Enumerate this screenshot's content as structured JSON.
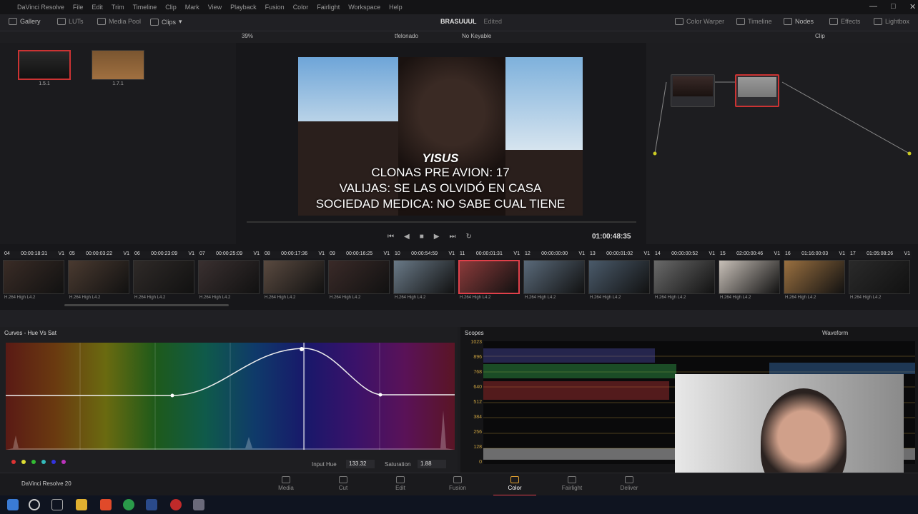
{
  "menu": {
    "app": "DaVinci Resolve",
    "items": [
      "File",
      "Edit",
      "Trim",
      "Timeline",
      "Clip",
      "Mark",
      "View",
      "Playback",
      "Fusion",
      "Color",
      "Fairlight",
      "Workspace",
      "Help"
    ]
  },
  "toolbar": {
    "gallery": "Gallery",
    "luts": "LUTs",
    "media_pool": "Media Pool",
    "clips": "Clips",
    "project": "BRASUUUL",
    "status": "Edited",
    "color_warper": "Color Warper",
    "timeline": "Timeline",
    "nodes": "Nodes",
    "effects": "Effects",
    "lightbox": "Lightbox"
  },
  "viewer": {
    "zoom": "39%",
    "clip_name": "tfelonado",
    "keyframe": "No Keyable",
    "mode": "Clip",
    "timecode": "01:00:48:35",
    "subtitle": {
      "name": "YISUS",
      "line1": "CLONAS PRE AVION: 17",
      "line2": "VALIJAS: SE LAS OLVIDÓ EN CASA",
      "line3": "SOCIEDAD MEDICA: NO SABE CUAL TIENE"
    }
  },
  "gallery": {
    "stills": [
      {
        "label": "1.5.1"
      },
      {
        "label": "1.7.1"
      }
    ]
  },
  "timeline": {
    "clips": [
      {
        "n": "04",
        "tc": "00:00:18:31",
        "tr": "V1",
        "codec": "H.264 High L4.2"
      },
      {
        "n": "05",
        "tc": "00:00:03:22",
        "tr": "V1",
        "codec": "H.264 High L4.2"
      },
      {
        "n": "06",
        "tc": "00:00:23:09",
        "tr": "V1",
        "codec": "H.264 High L4.2"
      },
      {
        "n": "07",
        "tc": "00:00:25:09",
        "tr": "V1",
        "codec": "H.264 High L4.2"
      },
      {
        "n": "08",
        "tc": "00:00:17:36",
        "tr": "V1",
        "codec": "H.264 High L4.2"
      },
      {
        "n": "09",
        "tc": "00:00:16:25",
        "tr": "V1",
        "codec": "H.264 High L4.2"
      },
      {
        "n": "10",
        "tc": "00:00:54:59",
        "tr": "V1",
        "codec": "H.264 High L4.2"
      },
      {
        "n": "11",
        "tc": "00:00:01:31",
        "tr": "V1",
        "codec": "H.264 High L4.2"
      },
      {
        "n": "12",
        "tc": "00:00:00:00",
        "tr": "V1",
        "codec": "H.264 High L4.2"
      },
      {
        "n": "13",
        "tc": "00:00:01:02",
        "tr": "V1",
        "codec": "H.264 High L4.2"
      },
      {
        "n": "14",
        "tc": "00:00:00:52",
        "tr": "V1",
        "codec": "H.264 High L4.2"
      },
      {
        "n": "15",
        "tc": "02:00:00:46",
        "tr": "V1",
        "codec": "H.264 High L4.2"
      },
      {
        "n": "16",
        "tc": "01:16:00:03",
        "tr": "V1",
        "codec": "H.264 High L4.2"
      },
      {
        "n": "17",
        "tc": "01:05:08:26",
        "tr": "V1",
        "codec": "H.264 High L4.2"
      }
    ]
  },
  "curves": {
    "title": "Curves - Hue Vs Sat",
    "input_hue_label": "Input Hue",
    "input_hue": "133.32",
    "saturation_label": "Saturation",
    "saturation": "1.88"
  },
  "scopes": {
    "title": "Scopes",
    "mode": "Waveform",
    "scale": [
      "1023",
      "896",
      "768",
      "640",
      "512",
      "384",
      "256",
      "128",
      "0"
    ]
  },
  "pages": [
    "Media",
    "Cut",
    "Edit",
    "Fusion",
    "Color",
    "Fairlight",
    "Deliver"
  ],
  "active_page": "Color",
  "brand": "DaVinci Resolve 20",
  "accent": "#e0404a"
}
